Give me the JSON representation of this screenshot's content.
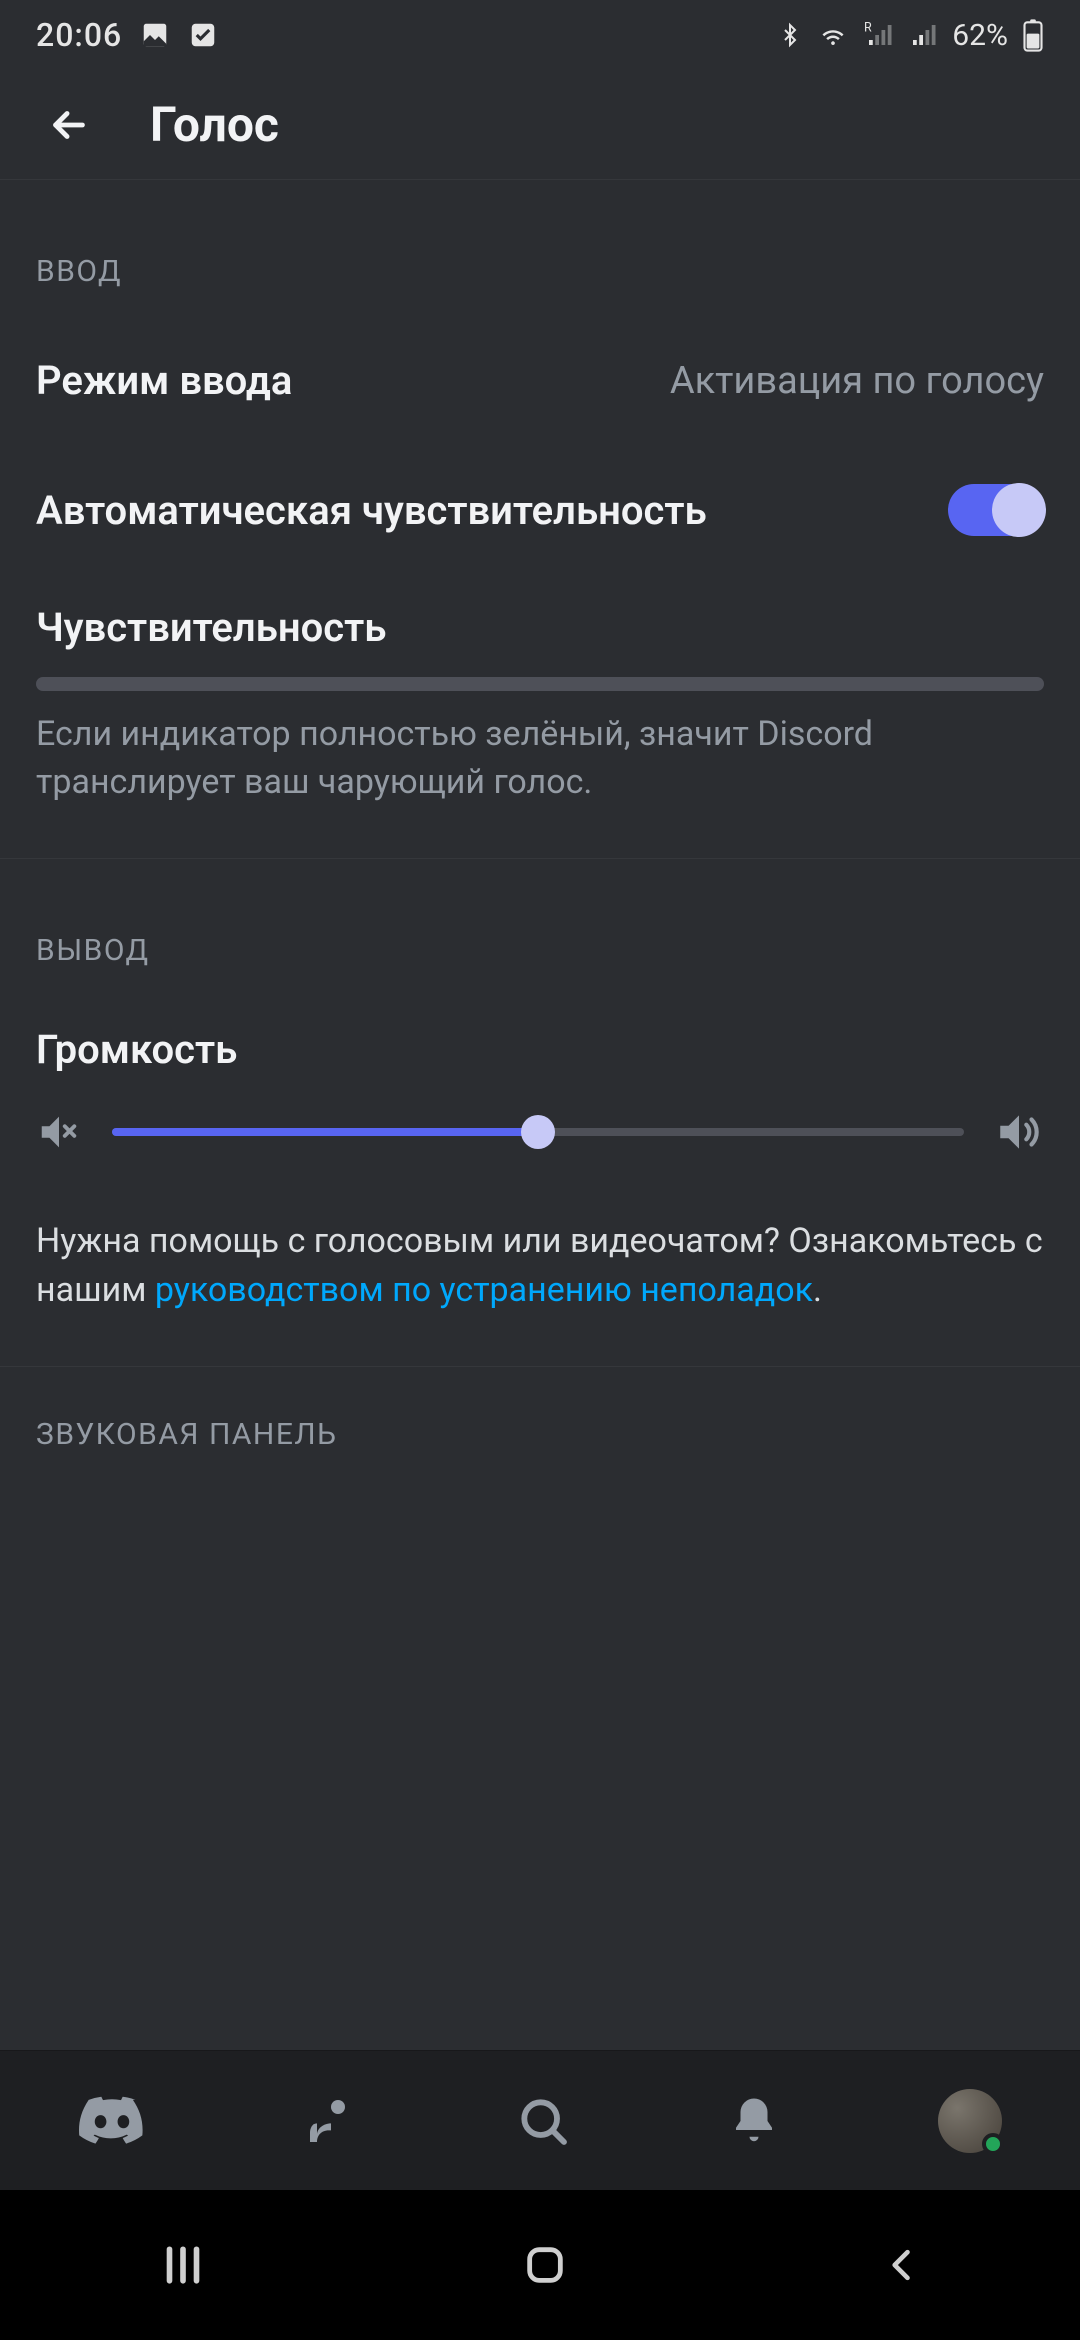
{
  "status": {
    "time": "20:06",
    "battery_text": "62%"
  },
  "header": {
    "title": "Голос"
  },
  "sections": {
    "input": {
      "header": "ВВОД",
      "input_mode": {
        "label": "Режим ввода",
        "value": "Активация по голосу"
      },
      "auto_sens": {
        "label": "Автоматическая чувствительность"
      },
      "sensitivity": {
        "label": "Чувствительность",
        "help": "Если индикатор полностью зелёный, значит Discord транслирует ваш чарующий голос."
      }
    },
    "output": {
      "header": "ВЫВОД",
      "volume": {
        "label": "Громкость",
        "percent": 50
      },
      "help_pre": "Нужна помощь с голосовым или видеочатом? Ознакомьтесь с нашим ",
      "help_link": "руководством по устранению неполадок",
      "help_post": "."
    },
    "soundboard": {
      "header": "ЗВУКОВАЯ ПАНЕЛЬ"
    }
  }
}
